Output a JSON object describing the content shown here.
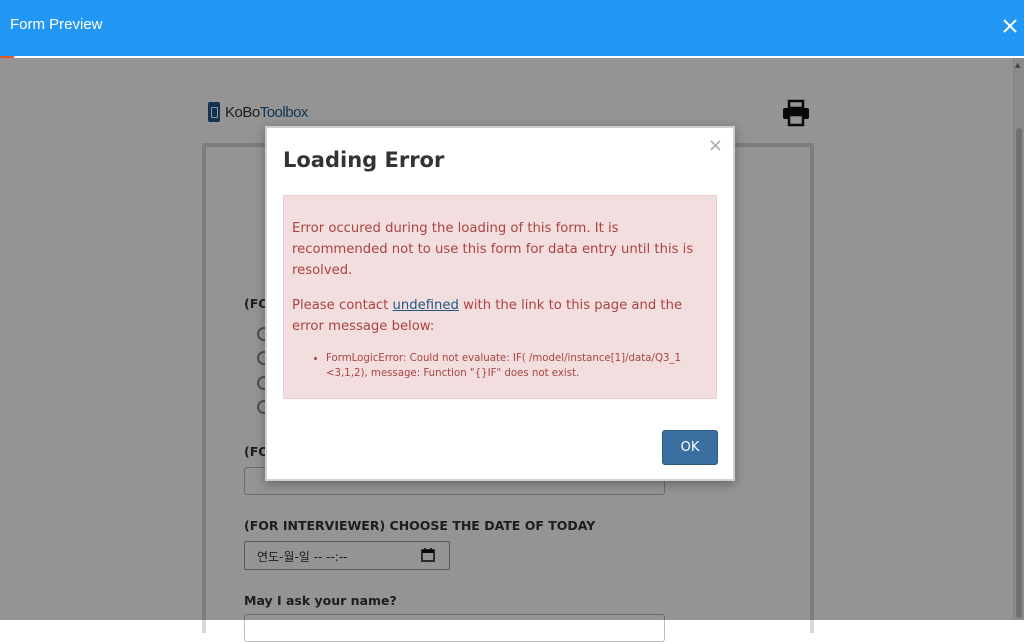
{
  "window": {
    "title": "Form Preview",
    "close_icon": "close-icon",
    "accent_color": "#2196f3"
  },
  "form": {
    "logo": {
      "part1": "KoBo",
      "part2": "Toolbox"
    },
    "print_icon": "print-icon",
    "questions": [
      {
        "label": "(FOR",
        "type": "select_one",
        "options_visible": 4
      },
      {
        "label": "(FO",
        "type": "text"
      },
      {
        "label": "(FOR INTERVIEWER) CHOOSE THE DATE OF TODAY",
        "type": "datetime",
        "value_placeholder": "연도-월-일 -- --:--"
      },
      {
        "label": "May I ask your name?",
        "type": "text"
      }
    ]
  },
  "modal": {
    "title": "Loading Error",
    "close_glyph": "×",
    "message1": "Error occured during the loading of this form. It is recommended not to use this form for data entry until this is resolved.",
    "message2_before": "Please contact ",
    "message2_link": "undefined",
    "message2_after": " with the link to this page and the error message below:",
    "errors": [
      "FormLogicError: Could not evaluate: IF( /model/instance[1]/data/Q3_1 <3,1,2), message: Function \"{}IF\" does not exist."
    ],
    "ok_label": "OK"
  }
}
